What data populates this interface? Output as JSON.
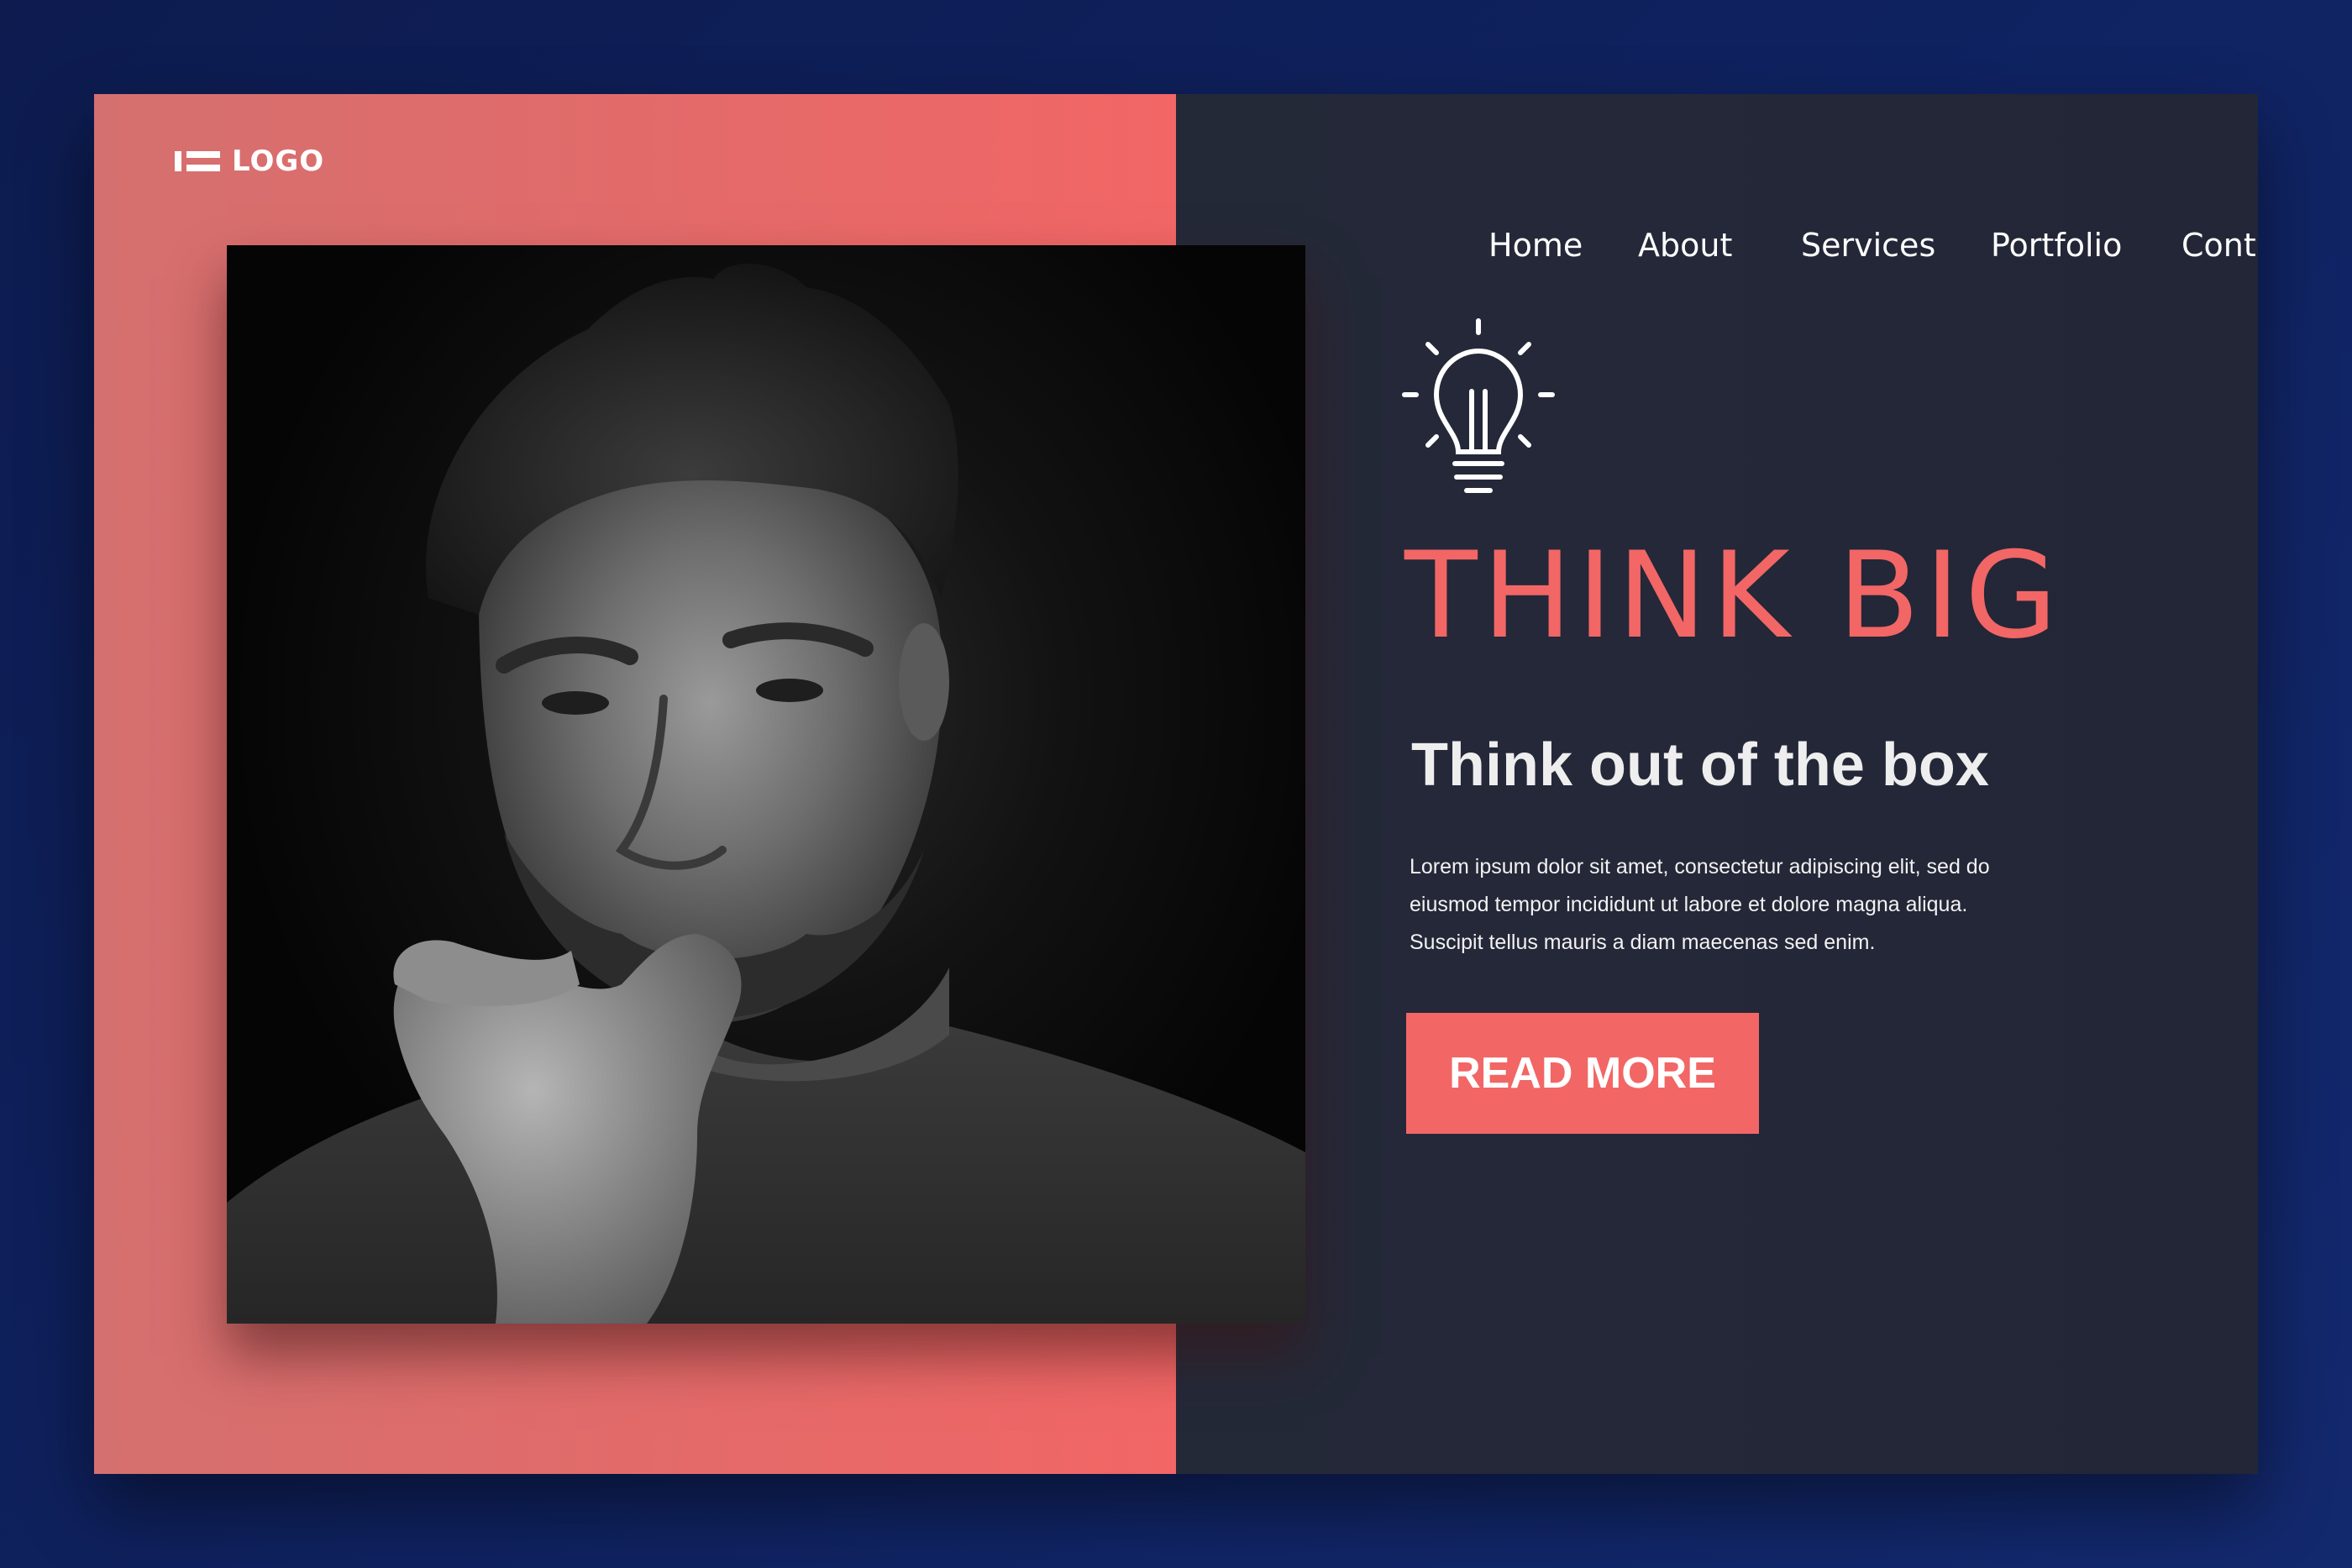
{
  "brand": {
    "logo_text": "LOGO"
  },
  "nav": {
    "items": [
      {
        "label": "Home"
      },
      {
        "label": "About"
      },
      {
        "label": "Services"
      },
      {
        "label": "Portfolio"
      },
      {
        "label": "Contact"
      }
    ]
  },
  "hero": {
    "icon": "lightbulb-icon",
    "headline": "THINK BIG",
    "subheadline": "Think out of the box",
    "body": "Lorem ipsum dolor sit amet, consectetur adipiscing elit, sed do eiusmod tempor incididunt ut labore et dolore magna aliqua. Suscipit tellus mauris a diam maecenas sed enim.",
    "cta_label": "READ MORE",
    "photo": "portrait-photo"
  },
  "colors": {
    "accent": "#f26666",
    "dark_panel": "#242938",
    "background": "#0f2260"
  }
}
